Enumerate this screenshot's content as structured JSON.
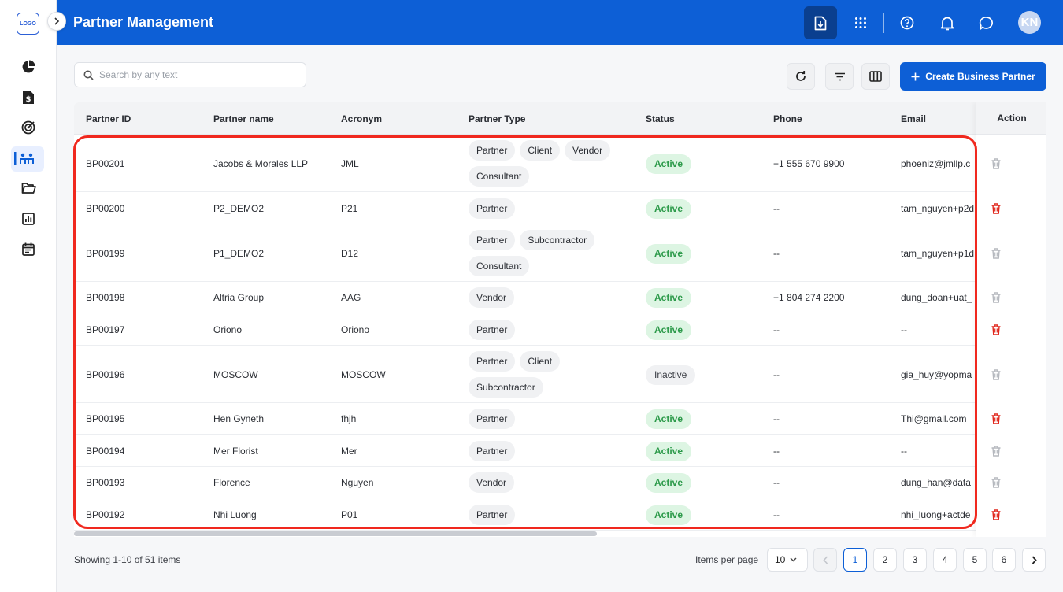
{
  "sidebar": {
    "logo_text": "LOGO",
    "items": [
      {
        "icon": "pie-chart-icon"
      },
      {
        "icon": "invoice-icon"
      },
      {
        "icon": "target-icon"
      },
      {
        "icon": "partners-icon",
        "active": true
      },
      {
        "icon": "folder-icon"
      },
      {
        "icon": "report-icon"
      },
      {
        "icon": "calendar-icon"
      }
    ]
  },
  "header": {
    "title": "Partner Management",
    "avatar_initials": "KN",
    "icons": [
      "download-icon",
      "apps-grid-icon",
      "help-icon",
      "bell-icon",
      "chat-icon"
    ]
  },
  "toolbar": {
    "search_placeholder": "Search by any text",
    "create_label": "Create Business Partner",
    "icons": [
      "refresh-icon",
      "filter-icon",
      "columns-icon"
    ]
  },
  "table": {
    "headers": {
      "id": "Partner ID",
      "name": "Partner name",
      "acronym": "Acronym",
      "type": "Partner Type",
      "status": "Status",
      "phone": "Phone",
      "email": "Email",
      "action": "Action"
    },
    "rows": [
      {
        "id": "BP00201",
        "name": "Jacobs & Morales LLP",
        "acronym": "JML",
        "types": [
          "Partner",
          "Client",
          "Vendor",
          "Consultant"
        ],
        "status": "Active",
        "phone": "+1 555 670 9900",
        "email": "phoeniz@jmllp.c",
        "delete_enabled": false
      },
      {
        "id": "BP00200",
        "name": "P2_DEMO2",
        "acronym": "P21",
        "types": [
          "Partner"
        ],
        "status": "Active",
        "phone": "--",
        "email": "tam_nguyen+p2d",
        "delete_enabled": true
      },
      {
        "id": "BP00199",
        "name": "P1_DEMO2",
        "acronym": "D12",
        "types": [
          "Partner",
          "Subcontractor",
          "Consultant"
        ],
        "status": "Active",
        "phone": "--",
        "email": "tam_nguyen+p1d",
        "delete_enabled": false
      },
      {
        "id": "BP00198",
        "name": "Altria Group",
        "acronym": "AAG",
        "types": [
          "Vendor"
        ],
        "status": "Active",
        "phone": "+1 804 274 2200",
        "email": "dung_doan+uat_",
        "delete_enabled": false
      },
      {
        "id": "BP00197",
        "name": "Oriono",
        "acronym": "Oriono",
        "types": [
          "Partner"
        ],
        "status": "Active",
        "phone": "--",
        "email": "--",
        "delete_enabled": true
      },
      {
        "id": "BP00196",
        "name": "MOSCOW",
        "acronym": "MOSCOW",
        "types": [
          "Partner",
          "Client",
          "Subcontractor"
        ],
        "status": "Inactive",
        "phone": "--",
        "email": "gia_huy@yopma",
        "delete_enabled": false
      },
      {
        "id": "BP00195",
        "name": "Hen Gyneth",
        "acronym": "fhjh",
        "types": [
          "Partner"
        ],
        "status": "Active",
        "phone": "--",
        "email": "Thi@gmail.com",
        "delete_enabled": true
      },
      {
        "id": "BP00194",
        "name": "Mer Florist",
        "acronym": "Mer",
        "types": [
          "Partner"
        ],
        "status": "Active",
        "phone": "--",
        "email": "--",
        "delete_enabled": false
      },
      {
        "id": "BP00193",
        "name": "Florence",
        "acronym": "Nguyen",
        "types": [
          "Vendor"
        ],
        "status": "Active",
        "phone": "--",
        "email": "dung_han@data",
        "delete_enabled": false
      },
      {
        "id": "BP00192",
        "name": "Nhi Luong",
        "acronym": "P01",
        "types": [
          "Partner"
        ],
        "status": "Active",
        "phone": "--",
        "email": "nhi_luong+actde",
        "delete_enabled": true
      }
    ]
  },
  "footer": {
    "showing": "Showing 1-10 of 51 items",
    "items_per_page_label": "Items per page",
    "items_per_page": "10",
    "pages": [
      "1",
      "2",
      "3",
      "4",
      "5",
      "6"
    ],
    "current_page": "1"
  }
}
